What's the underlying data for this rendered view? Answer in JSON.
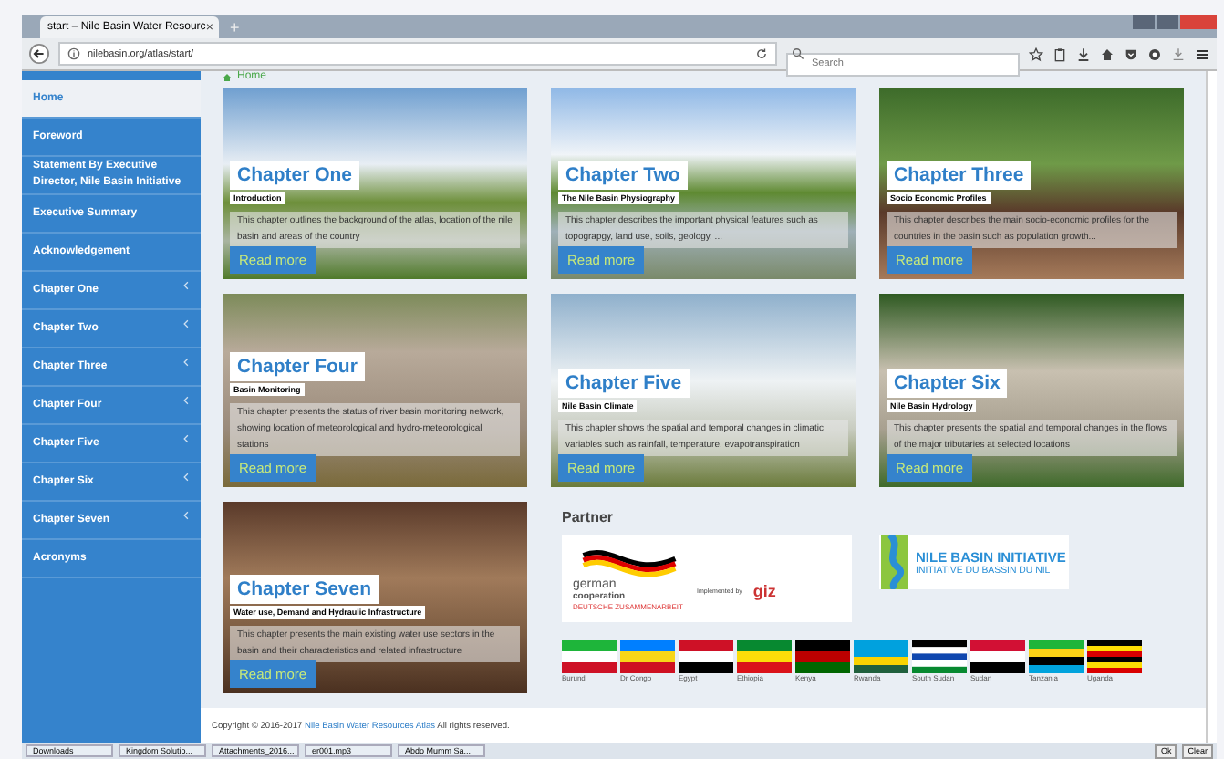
{
  "browser": {
    "tab_title": "start – Nile Basin Water Resourc",
    "tab_close": "×",
    "new_tab": "+",
    "url": "nilebasin.org/atlas/start/",
    "search": {
      "placeholder": "Search"
    }
  },
  "breadcrumb": "Home",
  "sidebar": {
    "items": [
      {
        "label": "Home",
        "selected": true,
        "kind": "link"
      },
      {
        "label": "Foreword",
        "selected": false,
        "kind": "link"
      },
      {
        "label": "Statement By Executive Director, Nile Basin Initiative",
        "selected": false,
        "kind": "link"
      },
      {
        "label": "Executive Summary",
        "selected": false,
        "kind": "link"
      },
      {
        "label": "Acknowledgement",
        "selected": false,
        "kind": "link"
      },
      {
        "label": "Chapter One",
        "selected": false,
        "kind": "submenu"
      },
      {
        "label": "Chapter Two",
        "selected": false,
        "kind": "submenu"
      },
      {
        "label": "Chapter Three",
        "selected": false,
        "kind": "submenu"
      },
      {
        "label": "Chapter Four",
        "selected": false,
        "kind": "submenu"
      },
      {
        "label": "Chapter Five",
        "selected": false,
        "kind": "submenu"
      },
      {
        "label": "Chapter Six",
        "selected": false,
        "kind": "submenu"
      },
      {
        "label": "Chapter Seven",
        "selected": false,
        "kind": "submenu"
      },
      {
        "label": "Acronyms",
        "selected": false,
        "kind": "link"
      }
    ]
  },
  "chapters": [
    {
      "title": "Chapter One",
      "subtitle": "Introduction",
      "description": "This chapter outlines the background of the atlas, location of the nile basin and areas of the country",
      "button": "Read more"
    },
    {
      "title": "Chapter Two",
      "subtitle": "The Nile Basin Physiography",
      "description": "This chapter describes the important physical features such as topograpgy, land use, soils, geology, ...",
      "button": "Read more"
    },
    {
      "title": "Chapter Three",
      "subtitle": "Socio Economic Profiles",
      "description": "This chapter describes the main socio-economic profiles for the countries in the basin such as population growth...",
      "button": "Read more"
    },
    {
      "title": "Chapter Four",
      "subtitle": "Basin Monitoring",
      "description": "This chapter presents the status of river basin monitoring network, showing location of meteorological and hydro-meteorological stations",
      "button": "Read more"
    },
    {
      "title": "Chapter Five",
      "subtitle": "Nile Basin Climate",
      "description": "This chapter shows the spatial and temporal changes in climatic variables such as rainfall, temperature, evapotranspiration",
      "button": "Read more"
    },
    {
      "title": "Chapter Six",
      "subtitle": "Nile Basin Hydrology",
      "description": "This chapter presents the spatial and temporal changes in the flows of the major tributaries at selected locations",
      "button": "Read more"
    },
    {
      "title": "Chapter Seven",
      "subtitle": "Water use, Demand and Hydraulic Infrastructure",
      "description": "This chapter presents the main existing water use sectors in the basin and their characteristics and related infrastructure",
      "button": "Read more"
    }
  ],
  "partner": {
    "heading": "Partner",
    "german": {
      "line1": "german",
      "line2": "cooperation",
      "line3": "DEUTSCHE ZUSAMMENARBEIT",
      "implemented": "Implemented by",
      "giz": "giz"
    },
    "nbi": {
      "line1": "NILE BASIN INITIATIVE",
      "line2": "INITIATIVE DU BASSIN DU NIL"
    },
    "flags": [
      "Burundi",
      "Dr Congo",
      "Egypt",
      "Ethiopia",
      "Kenya",
      "Rwanda",
      "South Sudan",
      "Sudan",
      "Tanzania",
      "Uganda"
    ]
  },
  "footer": {
    "prefix": "Copyright © 2016-2017",
    "link": "Nile Basin Water Resources Atlas",
    "suffix": "All rights reserved."
  },
  "taskbar": {
    "items": [
      "Downloads",
      "Kingdom Solutio...",
      "Attachments_2016...",
      "er001.mp3",
      "Abdo Mumm Sa..."
    ],
    "buttons": [
      "Ok",
      "Clear"
    ]
  }
}
